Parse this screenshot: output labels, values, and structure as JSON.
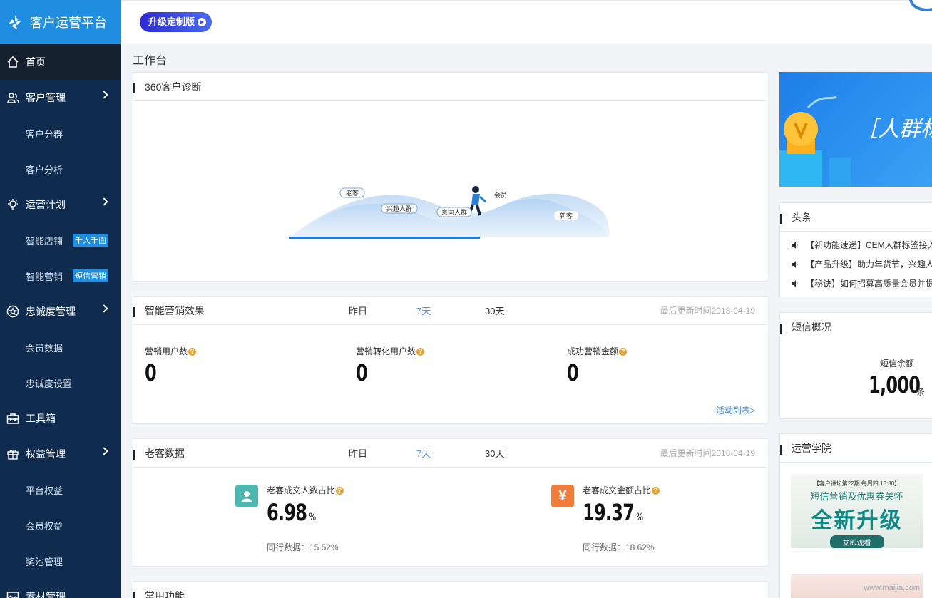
{
  "brand": {
    "name": "客户运营平台"
  },
  "sidebar": {
    "items": [
      {
        "label": "首页",
        "type": "main",
        "active": true,
        "icon": "home-icon"
      },
      {
        "label": "客户管理",
        "type": "main",
        "icon": "users-icon",
        "expandable": true
      },
      {
        "label": "客户分群",
        "type": "sub"
      },
      {
        "label": "客户分析",
        "type": "sub"
      },
      {
        "label": "运营计划",
        "type": "main",
        "icon": "lightbulb-icon",
        "expandable": true
      },
      {
        "label": "智能店铺",
        "type": "sub",
        "tag": "千人千面"
      },
      {
        "label": "智能营销",
        "type": "sub",
        "tag": "短信营销"
      },
      {
        "label": "忠诚度管理",
        "type": "main",
        "icon": "star-badge-icon",
        "expandable": true
      },
      {
        "label": "会员数据",
        "type": "sub"
      },
      {
        "label": "忠诚度设置",
        "type": "sub"
      },
      {
        "label": "工具箱",
        "type": "main",
        "icon": "toolbox-icon"
      },
      {
        "label": "权益管理",
        "type": "main",
        "icon": "gift-icon",
        "expandable": true
      },
      {
        "label": "平台权益",
        "type": "sub"
      },
      {
        "label": "会员权益",
        "type": "sub"
      },
      {
        "label": "奖池管理",
        "type": "sub"
      },
      {
        "label": "素材管理",
        "type": "main",
        "icon": "image-icon"
      }
    ]
  },
  "topbar": {
    "upgrade_label": "升级定制版"
  },
  "page": {
    "title": "工作台"
  },
  "diagnosis": {
    "title": "360客户诊断",
    "labels": [
      "老客",
      "兴趣人群",
      "意向人群",
      "会员",
      "新客"
    ]
  },
  "marketing": {
    "title": "智能营销效果",
    "periods": [
      "昨日",
      "7天",
      "30天"
    ],
    "selected_period": "7天",
    "updated": "最后更新时间2018-04-19",
    "metrics": [
      {
        "label": "营销用户数",
        "value": "0"
      },
      {
        "label": "营销转化用户数",
        "value": "0"
      },
      {
        "label": "成功营销金额",
        "value": "0"
      }
    ],
    "link": "活动列表>"
  },
  "old_customers": {
    "title": "老客数据",
    "periods": [
      "昨日",
      "7天",
      "30天"
    ],
    "selected_period": "7天",
    "updated": "最后更新时间2018-04-19",
    "metrics": [
      {
        "label": "老客成交人数占比",
        "value": "6.98",
        "unit": "%",
        "peer": "同行数据：15.52%",
        "icon": "person-icon",
        "color": "#4cb8b0"
      },
      {
        "label": "老客成交金额占比",
        "value": "19.37",
        "unit": "%",
        "peer": "同行数据：18.62%",
        "icon": "yen-icon",
        "color": "#f07d3c",
        "glyph": "¥"
      }
    ]
  },
  "common": {
    "title": "常用功能"
  },
  "ad": {
    "text": "［人群标"
  },
  "news": {
    "title": "头条",
    "items": [
      "【新功能速递】CEM人群标签接入",
      "【产品升级】助力年货节，兴趣人",
      "【秘诀】如何招募高质量会员并提"
    ]
  },
  "sms": {
    "title": "短信概况",
    "label": "短信余额",
    "value": "1,000",
    "unit": "条"
  },
  "academy": {
    "title": "运营学院",
    "banner": {
      "top": "【客户讲坛第22期 每周四 13:30】",
      "sub": "短信营销及优惠券关怀",
      "main": "全新升级",
      "button": "立即观看"
    },
    "watermark": "www.maijia.com"
  }
}
